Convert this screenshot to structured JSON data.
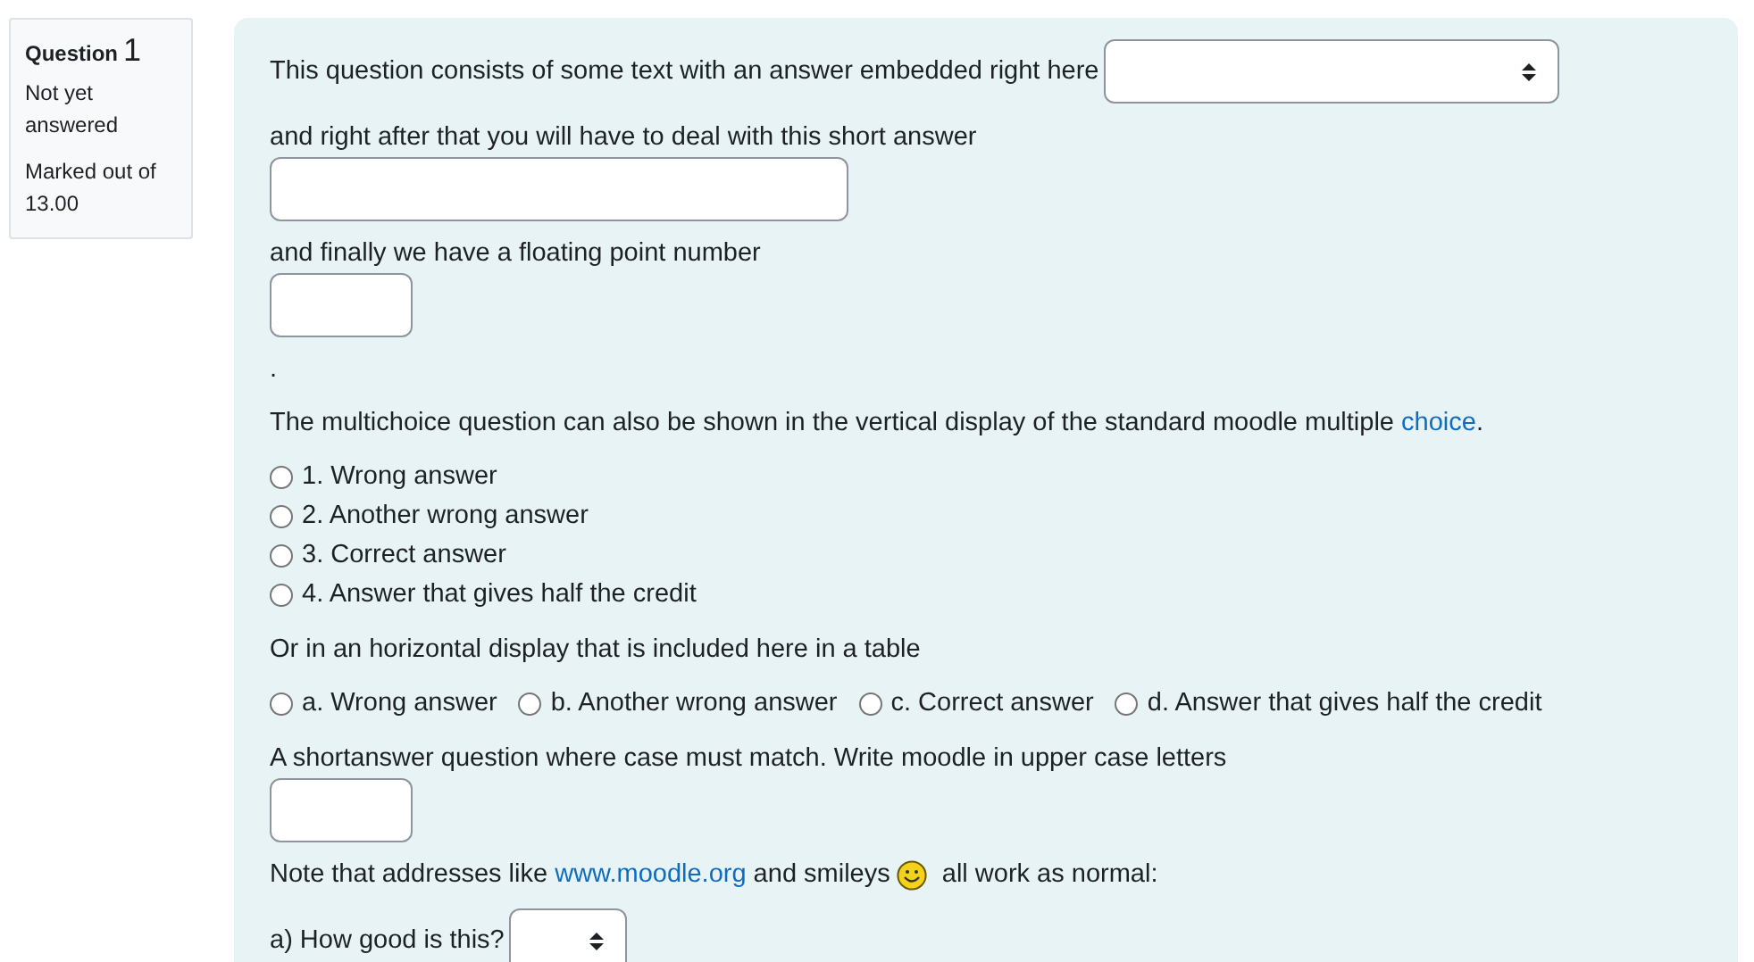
{
  "question_info": {
    "label": "Question",
    "number": "1",
    "state": "Not yet answered",
    "grade": "Marked out of 13.00"
  },
  "blocks": [
    {
      "kind": "line",
      "parts": [
        {
          "kind": "text",
          "text": "This question consists of some text with an answer embedded right here"
        },
        {
          "kind": "select-wide"
        }
      ]
    },
    {
      "kind": "line",
      "parts": [
        {
          "kind": "text",
          "text": "and right after that you will have to deal with this short answer"
        }
      ]
    },
    {
      "kind": "line",
      "parts": [
        {
          "kind": "input-long"
        }
      ]
    },
    {
      "kind": "line",
      "parts": [
        {
          "kind": "text",
          "text": "and finally we have a floating point number"
        }
      ]
    },
    {
      "kind": "line",
      "parts": [
        {
          "kind": "input-short"
        }
      ]
    },
    {
      "kind": "line",
      "parts": [
        {
          "kind": "text",
          "text": "."
        }
      ]
    },
    {
      "kind": "line",
      "parts": [
        {
          "kind": "text",
          "text": "The multichoice question can also be shown in the vertical display of the standard moodle multiple ",
          "link": "choice",
          "after": "."
        }
      ]
    },
    {
      "kind": "radio-column",
      "options": [
        {
          "label": "1. Wrong answer",
          "selected": false
        },
        {
          "label": "2. Another wrong answer",
          "selected": false
        },
        {
          "label": "3. Correct answer",
          "selected": false
        },
        {
          "label": "4. Answer that gives half the credit",
          "selected": false
        }
      ]
    },
    {
      "kind": "line",
      "parts": [
        {
          "kind": "text",
          "text": "Or in an horizontal display that is included here in a table"
        }
      ]
    },
    {
      "kind": "radio-row",
      "options": [
        {
          "label": "a. Wrong answer",
          "selected": false
        },
        {
          "label": "b. Another wrong answer",
          "selected": false
        },
        {
          "label": "c. Correct answer",
          "selected": false
        },
        {
          "label": "d. Answer that gives half the credit",
          "selected": false
        }
      ]
    },
    {
      "kind": "line",
      "parts": [
        {
          "kind": "text",
          "text": "A shortanswer question where case must match. Write moodle in upper case letters"
        }
      ]
    },
    {
      "kind": "line",
      "parts": [
        {
          "kind": "input-short"
        }
      ]
    },
    {
      "kind": "line",
      "parts": [
        {
          "kind": "text",
          "text": "Note that addresses like ",
          "link": "www.moodle.org",
          "after": " and smileys"
        },
        {
          "kind": "smiley"
        },
        {
          "kind": "text",
          "text": "all work as normal:"
        }
      ]
    },
    {
      "kind": "line",
      "parts": [
        {
          "kind": "text",
          "text": "a) How good is this?"
        },
        {
          "kind": "select-small"
        }
      ]
    }
  ]
}
